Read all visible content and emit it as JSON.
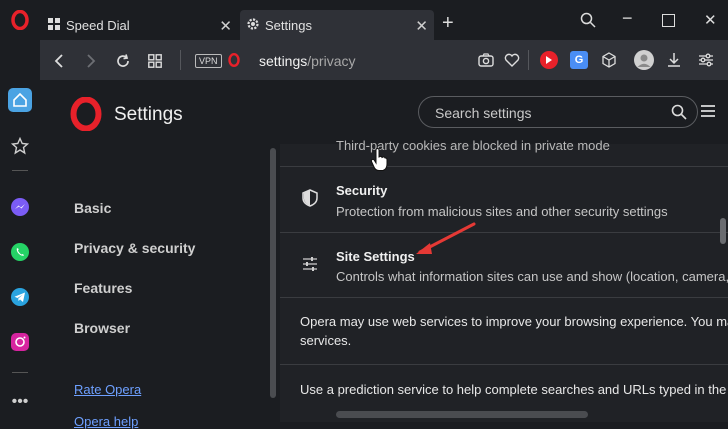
{
  "tabs": [
    {
      "label": "Speed Dial",
      "icon": "grid-icon"
    },
    {
      "label": "Settings",
      "icon": "gear-icon"
    }
  ],
  "addressbar": {
    "vpn_label": "VPN",
    "url_host": "settings",
    "url_path": "/privacy"
  },
  "header": {
    "title": "Settings",
    "search_placeholder": "Search settings"
  },
  "sidebar": {
    "items": [
      "Basic",
      "Privacy & security",
      "Features",
      "Browser"
    ],
    "links": [
      "Rate Opera",
      "Opera help"
    ]
  },
  "content": {
    "cookies_text": "Third-party cookies are blocked in private mode",
    "security": {
      "title": "Security",
      "subtitle": "Protection from malicious sites and other security settings"
    },
    "site_settings": {
      "title": "Site Settings",
      "subtitle": "Controls what information sites can use and show (location, camera, pop"
    },
    "web_services_line1": "Opera may use web services to improve your browsing experience. You may",
    "web_services_line2": "services.",
    "prediction_text": "Use a prediction service to help complete searches and URLs typed in the ad"
  },
  "colors": {
    "opera_red": "#e8212a",
    "accent_blue": "#4a8ef5",
    "annotation_arrow": "#e53935"
  }
}
